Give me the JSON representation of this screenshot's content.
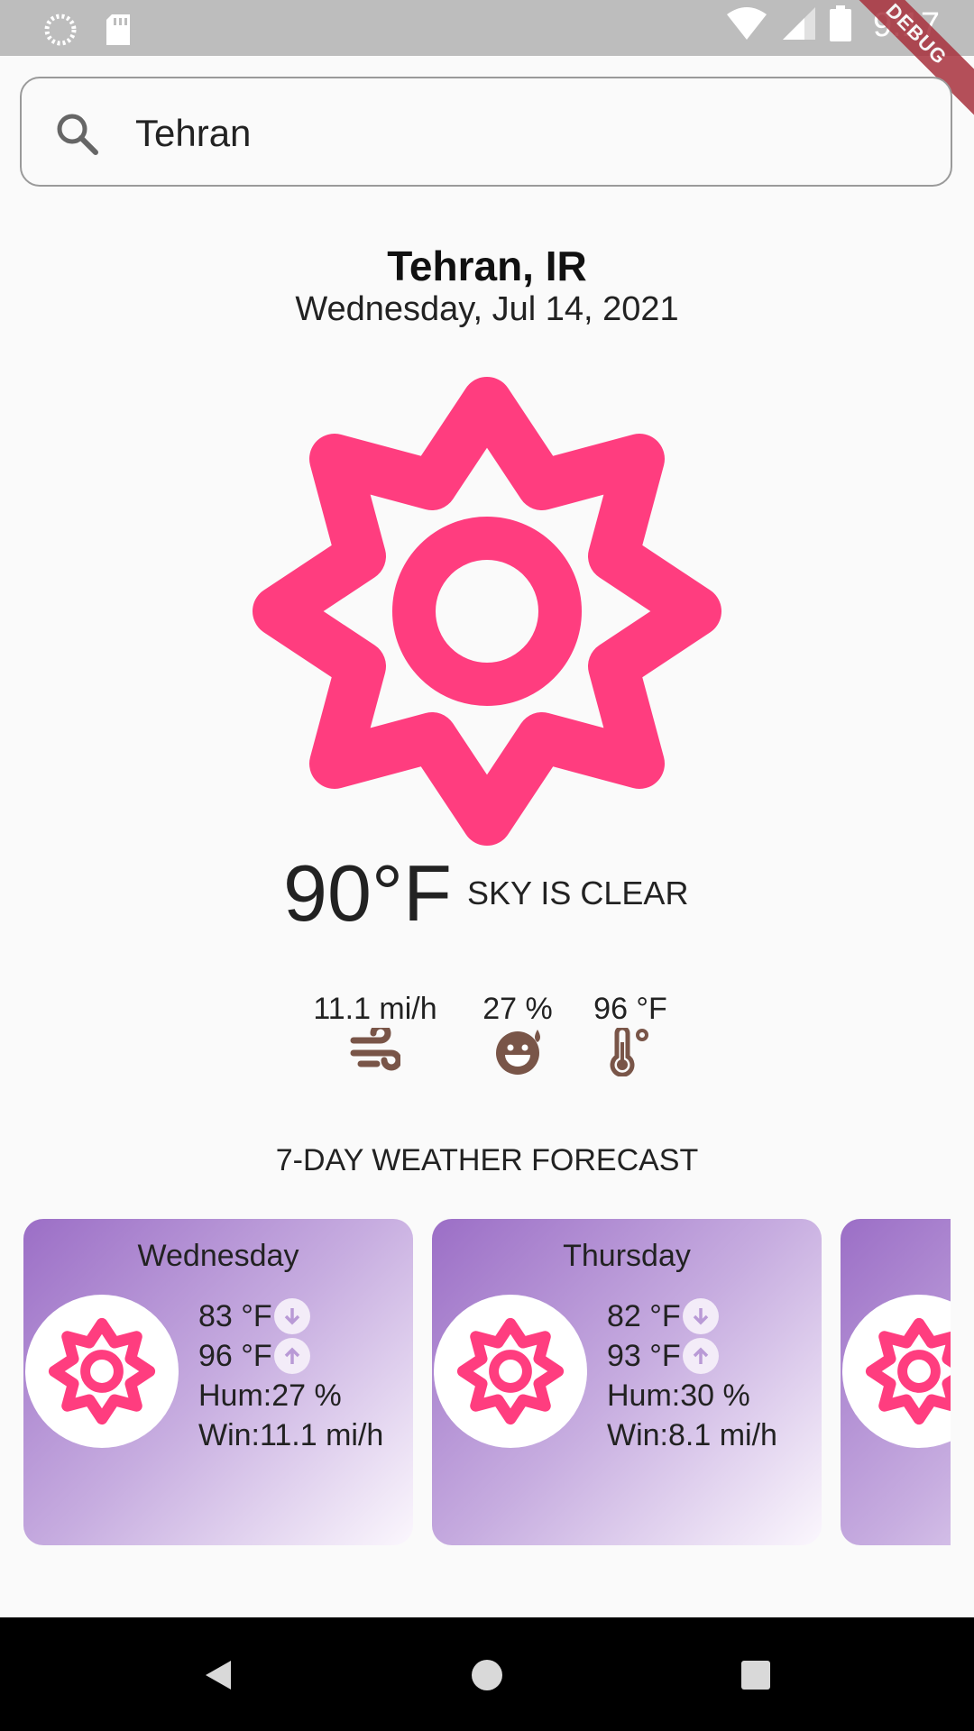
{
  "status_bar": {
    "time": "9:17"
  },
  "debug_banner": "DEBUG",
  "search": {
    "value": "Tehran",
    "placeholder": ""
  },
  "location": {
    "city": "Tehran, IR",
    "date": "Wednesday, Jul 14, 2021"
  },
  "current": {
    "temperature": "90°F",
    "description": "SKY IS CLEAR",
    "wind": "11.1 mi/h",
    "humidity": "27 %",
    "max_temp": "96 °F"
  },
  "forecast": {
    "title": "7-DAY WEATHER FORECAST",
    "days": [
      {
        "day": "Wednesday",
        "min": "83 °F",
        "max": "96 °F",
        "humidity": "Hum:27 %",
        "wind": "Win:11.1 mi/h"
      },
      {
        "day": "Thursday",
        "min": "82 °F",
        "max": "93 °F",
        "humidity": "Hum:30 %",
        "wind": "Win:8.1 mi/h"
      }
    ]
  },
  "icons": {
    "sun": "sun-icon",
    "wind": "wind-icon",
    "humidity": "smile-drop-icon",
    "temperature": "thermometer-icon",
    "min": "arrow-down-icon",
    "max": "arrow-up-icon"
  },
  "colors": {
    "accent": "#ff3d7f",
    "icon_brown": "#795548",
    "card_purple": "#9b6ec6"
  }
}
